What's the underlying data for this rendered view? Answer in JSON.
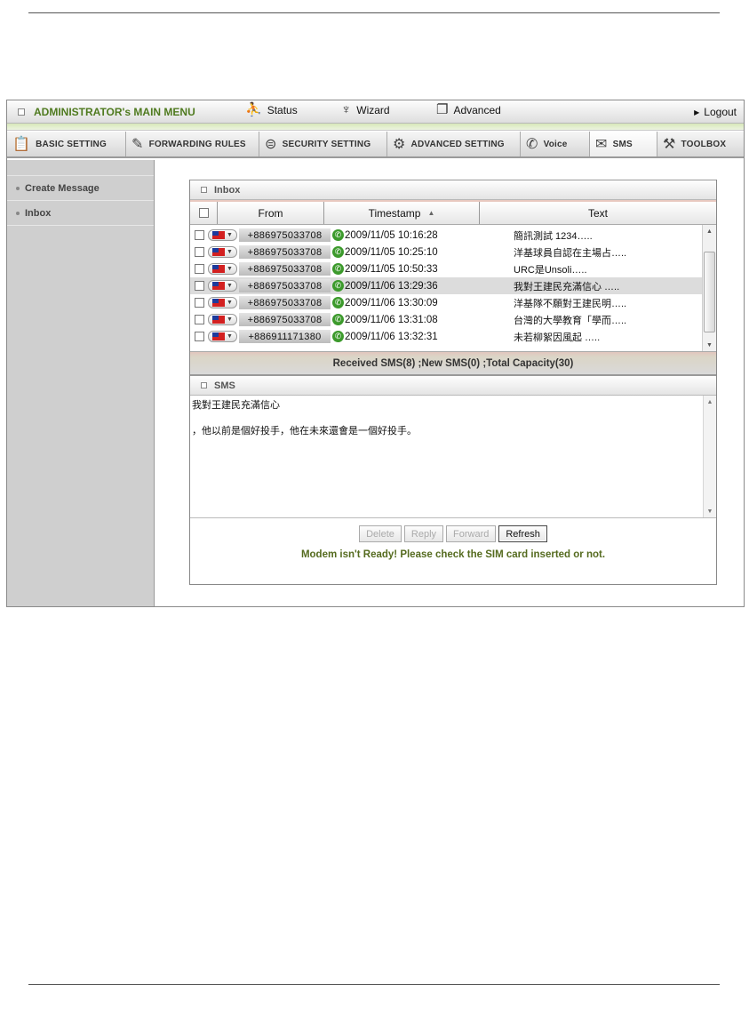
{
  "topmenu": {
    "title": "ADMINISTRATOR's MAIN MENU",
    "items": [
      {
        "label": "Status",
        "icon": "status-icon"
      },
      {
        "label": "Wizard",
        "icon": "wizard-icon"
      },
      {
        "label": "Advanced",
        "icon": "advanced-icon"
      }
    ],
    "logout": "Logout"
  },
  "tabs": [
    {
      "label": "BASIC SETTING",
      "icon": "basic-setting-icon"
    },
    {
      "label": "FORWARDING RULES",
      "icon": "forwarding-rules-icon"
    },
    {
      "label": "SECURITY SETTING",
      "icon": "security-setting-icon"
    },
    {
      "label": "ADVANCED SETTING",
      "icon": "advanced-setting-icon"
    },
    {
      "label": "Voice",
      "icon": "phone-icon"
    },
    {
      "label": "SMS",
      "icon": "envelope-icon",
      "active": true
    },
    {
      "label": "TOOLBOX",
      "icon": "toolbox-icon"
    }
  ],
  "sidebar": {
    "items": [
      {
        "label": "Create Message"
      },
      {
        "label": "Inbox"
      }
    ]
  },
  "inbox": {
    "title": "Inbox",
    "columns": {
      "from": "From",
      "timestamp": "Timestamp",
      "text": "Text"
    },
    "sort_indicator": "▲",
    "rows": [
      {
        "from": "+886975033708",
        "timestamp": "2009/11/05 10:16:28",
        "text": "簡訊測試 1234….."
      },
      {
        "from": "+886975033708",
        "timestamp": "2009/11/05 10:25:10",
        "text": "洋基球員自認在主場占….."
      },
      {
        "from": "+886975033708",
        "timestamp": "2009/11/05 10:50:33",
        "text": "URC是Unsoli….."
      },
      {
        "from": "+886975033708",
        "timestamp": "2009/11/06 13:29:36",
        "text": "我對王建民充滿信心 …..",
        "selected": true
      },
      {
        "from": "+886975033708",
        "timestamp": "2009/11/06 13:30:09",
        "text": "洋基隊不願對王建民明….."
      },
      {
        "from": "+886975033708",
        "timestamp": "2009/11/06 13:31:08",
        "text": "台灣的大學教育「學而….."
      },
      {
        "from": "+886911171380",
        "timestamp": "2009/11/06 13:32:31",
        "text": "未若柳絮因風起 ….."
      }
    ],
    "summary": "Received SMS(8) ;New SMS(0) ;Total Capacity(30)"
  },
  "sms": {
    "title": "SMS",
    "lines": [
      "我對王建民充滿信心",
      "，他以前是個好投手，他在未來還會是一個好投手。"
    ],
    "buttons": {
      "delete": "Delete",
      "reply": "Reply",
      "forward": "Forward",
      "refresh": "Refresh"
    },
    "warning": "Modem isn't Ready! Please check the SIM card inserted or not."
  }
}
